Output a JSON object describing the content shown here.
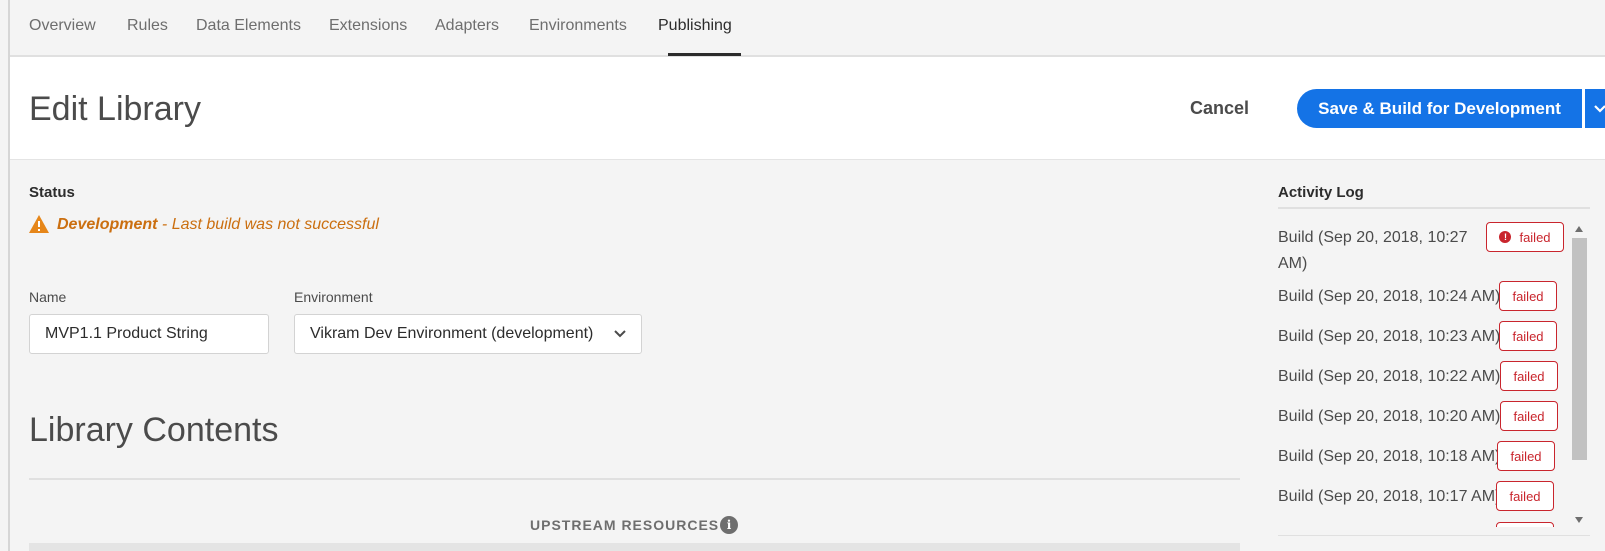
{
  "tabs": [
    {
      "label": "Overview"
    },
    {
      "label": "Rules"
    },
    {
      "label": "Data Elements"
    },
    {
      "label": "Extensions"
    },
    {
      "label": "Adapters"
    },
    {
      "label": "Environments"
    },
    {
      "label": "Publishing",
      "active": true
    }
  ],
  "header": {
    "title": "Edit Library",
    "cancel_label": "Cancel",
    "save_label": "Save & Build for Development"
  },
  "status": {
    "label": "Status",
    "environment": "Development",
    "message": " - Last build was not successful"
  },
  "form": {
    "name_label": "Name",
    "name_value": "MVP1.1 Product String",
    "environment_label": "Environment",
    "environment_value": "Vikram Dev Environment (development)"
  },
  "library": {
    "title": "Library Contents",
    "upstream_label": "UPSTREAM RESOURCES",
    "upstream_info_icon": "info-icon"
  },
  "activity_log": {
    "title": "Activity Log",
    "entries": [
      {
        "line1": "Build (Sep 20, 2018, 10:27",
        "line2": "AM)",
        "status": "failed",
        "has_icon": true
      },
      {
        "line1": "Build (Sep 20, 2018, 10:24 AM)",
        "status": "failed"
      },
      {
        "line1": "Build (Sep 20, 2018, 10:23 AM)",
        "status": "failed"
      },
      {
        "line1": "Build (Sep 20, 2018, 10:22 AM)",
        "status": "failed"
      },
      {
        "line1": "Build (Sep 20, 2018, 10:20 AM)",
        "status": "failed"
      },
      {
        "line1": "Build (Sep 20, 2018, 10:18 AM)",
        "status": "failed"
      },
      {
        "line1": "Build (Sep 20, 2018, 10:17 AM)",
        "status": "failed"
      }
    ]
  },
  "colors": {
    "accent": "#1473e6",
    "warning": "#cb6f10",
    "error": "#c9252d"
  }
}
